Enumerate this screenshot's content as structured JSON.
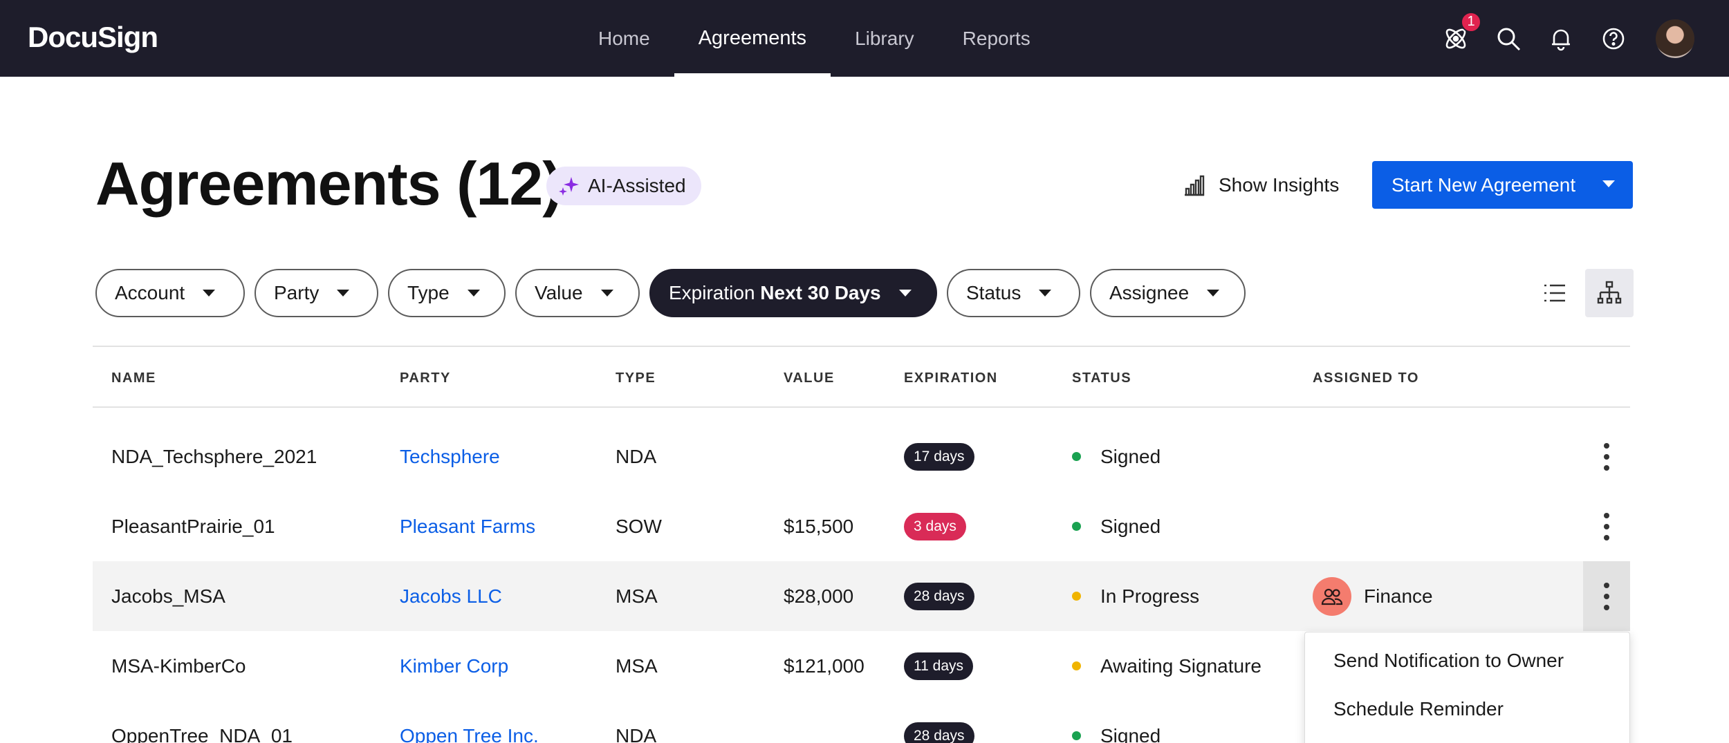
{
  "app": {
    "logo": "DocuSign"
  },
  "nav": {
    "links": [
      {
        "label": "Home",
        "active": false
      },
      {
        "label": "Agreements",
        "active": true
      },
      {
        "label": "Library",
        "active": false
      },
      {
        "label": "Reports",
        "active": false
      }
    ],
    "icons": [
      "ai-agent-icon",
      "search-icon",
      "bell-icon",
      "help-icon"
    ],
    "notification_count": "1"
  },
  "header": {
    "title": "Agreements (12)",
    "ai_chip": "AI-Assisted",
    "insights_label": "Show Insights",
    "primary_action": "Start New Agreement"
  },
  "filters": {
    "account": "Account",
    "party": "Party",
    "type": "Type",
    "value": "Value",
    "expiration_label": "Expiration",
    "expiration_value": "Next 30 Days",
    "status": "Status",
    "assignee": "Assignee"
  },
  "table": {
    "columns": {
      "name": "NAME",
      "party": "PARTY",
      "type": "TYPE",
      "value": "VALUE",
      "expiration": "EXPIRATION",
      "status": "STATUS",
      "assigned_to": "ASSIGNED TO"
    },
    "rows": [
      {
        "name": "NDA_Techsphere_2021",
        "party": "Techsphere",
        "type": "NDA",
        "value": "",
        "expiration": "17 days",
        "expiration_urgent": false,
        "status": "Signed",
        "status_color": "#1aa251",
        "assignee": ""
      },
      {
        "name": "PleasantPrairie_01",
        "party": "Pleasant Farms",
        "type": "SOW",
        "value": "$15,500",
        "expiration": "3 days",
        "expiration_urgent": true,
        "status": "Signed",
        "status_color": "#1aa251",
        "assignee": ""
      },
      {
        "name": "Jacobs_MSA",
        "party": "Jacobs LLC",
        "type": "MSA",
        "value": "$28,000",
        "expiration": "28 days",
        "expiration_urgent": false,
        "status": "In Progress",
        "status_color": "#f0b400",
        "assignee": "Finance"
      },
      {
        "name": "MSA-KimberCo",
        "party": "Kimber Corp",
        "type": "MSA",
        "value": "$121,000",
        "expiration": "11 days",
        "expiration_urgent": false,
        "status": "Awaiting Signature",
        "status_color": "#f0b400",
        "assignee": ""
      },
      {
        "name": "OppenTree_NDA_01",
        "party": "Oppen Tree Inc.",
        "type": "NDA",
        "value": "",
        "expiration": "28 days",
        "expiration_urgent": false,
        "status": "Signed",
        "status_color": "#1aa251",
        "assignee": ""
      }
    ]
  },
  "row_menu": {
    "items": [
      "Send Notification to Owner",
      "Schedule Reminder"
    ]
  },
  "colors": {
    "nav_bg": "#1e1d2b",
    "primary": "#0b5ee6",
    "link": "#0b5ee6",
    "urgent": "#d92b57",
    "ai_chip_bg": "#ece6fb"
  }
}
